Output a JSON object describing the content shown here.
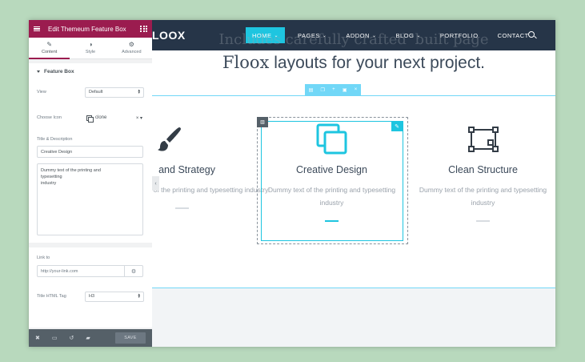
{
  "panel": {
    "header_title": "Edit Themeum Feature Box",
    "tabs": [
      {
        "label": "Content",
        "icon": "pencil-icon"
      },
      {
        "label": "Style",
        "icon": "contrast-icon"
      },
      {
        "label": "Advanced",
        "icon": "gear-icon"
      }
    ],
    "section_title": "Feature Box",
    "view": {
      "label": "View",
      "value": "Default"
    },
    "choose_icon": {
      "label": "Choose Icon",
      "value": "clone"
    },
    "title_desc_label": "Title & Description",
    "title_value": "Creative Design",
    "description_value": "Dummy text of the printing and\ntypesetting\nindustry",
    "link": {
      "label": "Link to",
      "placeholder": "http://your-link.com"
    },
    "title_tag": {
      "label": "Title HTML Tag",
      "value": "H3"
    },
    "footer": {
      "save_label": "SAVE"
    }
  },
  "site": {
    "logo": "LOOX",
    "nav": [
      {
        "label": "HOME",
        "dropdown": true,
        "active": true
      },
      {
        "label": "PAGES",
        "dropdown": true
      },
      {
        "label": "ADDON",
        "dropdown": true
      },
      {
        "label": "BLOG",
        "dropdown": true
      },
      {
        "label": "PORTFOLIO",
        "dropdown": false
      },
      {
        "label": "CONTACT",
        "dropdown": false
      }
    ],
    "headline_faded": "Includes carefully crafted 'built page",
    "headline_serif": "Floox",
    "headline_rest": " layouts for your next project.",
    "features": [
      {
        "title": "and Strategy",
        "desc": "of the printing and typesetting industry",
        "icon": "brush-icon"
      },
      {
        "title": "Creative Design",
        "desc": "Dummy text of the printing and typesetting industry",
        "icon": "clone-icon"
      },
      {
        "title": "Clean Structure",
        "desc": "Dummy text of the printing and typesetting industry",
        "icon": "vector-square-icon"
      }
    ]
  },
  "colors": {
    "accent": "#1ec5e0",
    "panel_header": "#9b1c4f",
    "navbar": "#263548"
  }
}
